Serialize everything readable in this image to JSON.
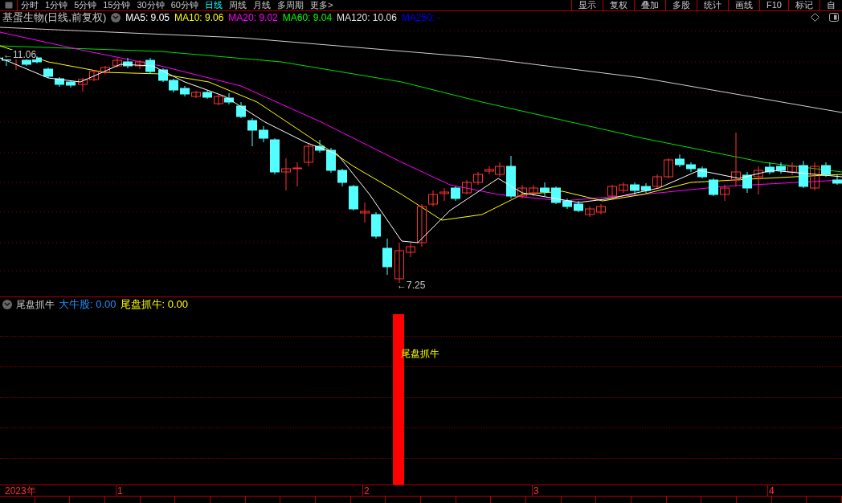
{
  "toolbar": {
    "periods": [
      {
        "label": "分时",
        "selected": false
      },
      {
        "label": "1分钟",
        "selected": false
      },
      {
        "label": "5分钟",
        "selected": false
      },
      {
        "label": "15分钟",
        "selected": false
      },
      {
        "label": "30分钟",
        "selected": false
      },
      {
        "label": "60分钟",
        "selected": false
      },
      {
        "label": "日线",
        "selected": true
      },
      {
        "label": "周线",
        "selected": false
      },
      {
        "label": "月线",
        "selected": false
      },
      {
        "label": "多周期",
        "selected": false
      },
      {
        "label": "更多>",
        "selected": false
      }
    ],
    "buttons": [
      "显示",
      "复权",
      "叠加",
      "多股",
      "统计",
      "画线",
      "F10",
      "标记",
      "自"
    ]
  },
  "chart_header": {
    "title": "基蛋生物(日线,前复权)",
    "moving_averages": [
      {
        "label": "MA5: 9.05",
        "color": "#ffffff"
      },
      {
        "label": "MA10: 9.06",
        "color": "#ffff00"
      },
      {
        "label": "MA20: 9.02",
        "color": "#ff00ff"
      },
      {
        "label": "MA60: 9.04",
        "color": "#00ff00"
      },
      {
        "label": "MA120: 10.06",
        "color": "#e0e0e0"
      },
      {
        "label": "MA250: -",
        "color": "#0000ff"
      }
    ]
  },
  "price_chart": {
    "high_marker": "←11.06",
    "low_marker": "←7.25"
  },
  "indicator": {
    "name": "尾盘抓牛",
    "values": [
      {
        "label": "大牛股: 0.00",
        "color": "#1e90ff"
      },
      {
        "label": "尾盘抓牛: 0.00",
        "color": "#ffff00"
      }
    ],
    "signal_label": "尾盘抓牛"
  },
  "time_axis": [
    "2023年",
    "1",
    "2",
    "3",
    "4"
  ]
}
